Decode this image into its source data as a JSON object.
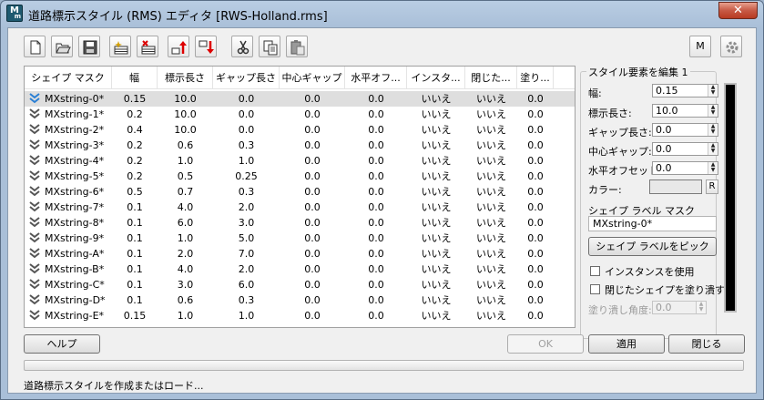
{
  "window": {
    "title": "道路標示スタイル (RMS) エディタ [RWS-Holland.rms]",
    "icon_letter": "M",
    "icon_sub": "m",
    "close_label": "✕"
  },
  "toolbar": {
    "buttons": [
      "new-file-icon",
      "open-folder-icon",
      "save-icon",
      "add-row-icon",
      "delete-row-icon",
      "move-up-icon",
      "move-down-icon",
      "cut-icon",
      "copy-icon",
      "paste-icon"
    ],
    "m_label": "M",
    "settings_icon": "gear-icon"
  },
  "grid": {
    "headers": [
      "シェイプ マスク",
      "幅",
      "標示長さ",
      "ギャップ長さ",
      "中心ギャップ",
      "水平オフ...",
      "インスタ...",
      "閉じた...",
      "塗り..."
    ],
    "rows": [
      [
        "MXstring-0*",
        "0.15",
        "10.0",
        "0.0",
        "0.0",
        "0.0",
        "いいえ",
        "いいえ",
        "0.0"
      ],
      [
        "MXstring-1*",
        "0.2",
        "10.0",
        "0.0",
        "0.0",
        "0.0",
        "いいえ",
        "いいえ",
        "0.0"
      ],
      [
        "MXstring-2*",
        "0.4",
        "10.0",
        "0.0",
        "0.0",
        "0.0",
        "いいえ",
        "いいえ",
        "0.0"
      ],
      [
        "MXstring-3*",
        "0.2",
        "0.6",
        "0.3",
        "0.0",
        "0.0",
        "いいえ",
        "いいえ",
        "0.0"
      ],
      [
        "MXstring-4*",
        "0.2",
        "1.0",
        "1.0",
        "0.0",
        "0.0",
        "いいえ",
        "いいえ",
        "0.0"
      ],
      [
        "MXstring-5*",
        "0.2",
        "0.5",
        "0.25",
        "0.0",
        "0.0",
        "いいえ",
        "いいえ",
        "0.0"
      ],
      [
        "MXstring-6*",
        "0.5",
        "0.7",
        "0.3",
        "0.0",
        "0.0",
        "いいえ",
        "いいえ",
        "0.0"
      ],
      [
        "MXstring-7*",
        "0.1",
        "4.0",
        "2.0",
        "0.0",
        "0.0",
        "いいえ",
        "いいえ",
        "0.0"
      ],
      [
        "MXstring-8*",
        "0.1",
        "6.0",
        "3.0",
        "0.0",
        "0.0",
        "いいえ",
        "いいえ",
        "0.0"
      ],
      [
        "MXstring-9*",
        "0.1",
        "1.0",
        "5.0",
        "0.0",
        "0.0",
        "いいえ",
        "いいえ",
        "0.0"
      ],
      [
        "MXstring-A*",
        "0.1",
        "2.0",
        "7.0",
        "0.0",
        "0.0",
        "いいえ",
        "いいえ",
        "0.0"
      ],
      [
        "MXstring-B*",
        "0.1",
        "4.0",
        "2.0",
        "0.0",
        "0.0",
        "いいえ",
        "いいえ",
        "0.0"
      ],
      [
        "MXstring-C*",
        "0.1",
        "3.0",
        "6.0",
        "0.0",
        "0.0",
        "いいえ",
        "いいえ",
        "0.0"
      ],
      [
        "MXstring-D*",
        "0.1",
        "0.6",
        "0.3",
        "0.0",
        "0.0",
        "いいえ",
        "いいえ",
        "0.0"
      ],
      [
        "MXstring-E*",
        "0.15",
        "1.0",
        "1.0",
        "0.0",
        "0.0",
        "いいえ",
        "いいえ",
        "0.0"
      ]
    ]
  },
  "panel": {
    "legend": "スタイル要素を編集 1",
    "width_label": "幅:",
    "width_value": "0.15",
    "dash_label": "標示長さ:",
    "dash_value": "10.0",
    "gap_label": "ギャップ長さ:",
    "gap_value": "0.0",
    "center_gap_label": "中心ギャップ:",
    "center_gap_value": "0.0",
    "h_offset_label": "水平オフセット:",
    "h_offset_value": "0.0",
    "color_label": "カラー:",
    "color_reset": "R",
    "shape_mask_label": "シェイプ ラベル マスク",
    "shape_mask_value": "MXstring-0*",
    "pick_button": "シェイプ ラベルをピック",
    "use_instance_label": "インスタンスを使用",
    "fill_closed_label": "閉じたシェイプを塗り潰す",
    "fill_angle_label": "塗り潰し角度:",
    "fill_angle_value": "0.0"
  },
  "buttons": {
    "help": "ヘルプ",
    "ok": "OK",
    "apply": "適用",
    "close": "閉じる"
  },
  "status": "道路標示スタイルを作成またはロード..."
}
